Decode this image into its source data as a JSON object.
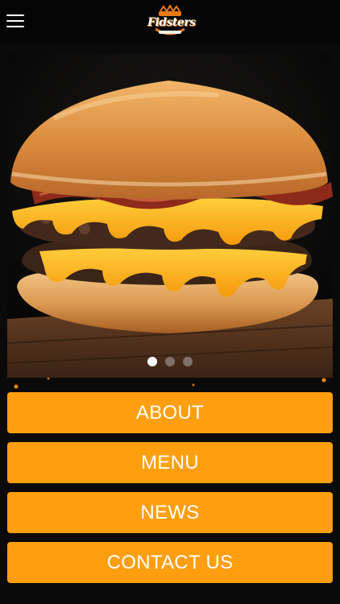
{
  "header": {
    "menu_icon": "hamburger-menu-icon",
    "logo_text": "Fidsters"
  },
  "hero": {
    "image": "double cheeseburger with bacon",
    "slides_total": 3,
    "active_slide": 1
  },
  "nav": {
    "items": [
      {
        "label": "ABOUT"
      },
      {
        "label": "MENU"
      },
      {
        "label": "NEWS"
      },
      {
        "label": "CONTACT US"
      }
    ]
  },
  "colors": {
    "accent": "#ff9f0f",
    "background": "#0a0a0a",
    "topbar": "#050505",
    "text": "#ffffff"
  }
}
